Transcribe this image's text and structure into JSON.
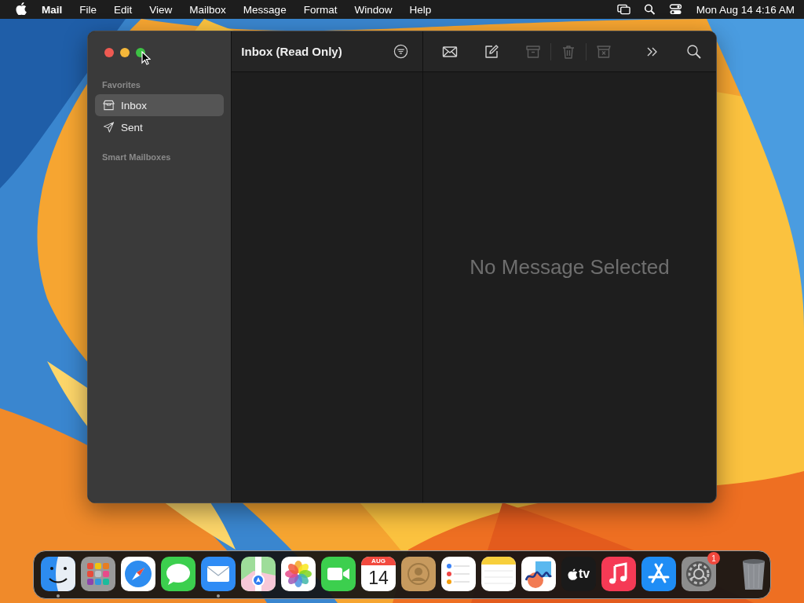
{
  "menu_bar": {
    "app_name": "Mail",
    "menus": [
      "File",
      "Edit",
      "View",
      "Mailbox",
      "Message",
      "Format",
      "Window",
      "Help"
    ],
    "clock": "Mon Aug 14 4:16 AM"
  },
  "window": {
    "sidebar": {
      "sections": [
        {
          "heading": "Favorites",
          "items": [
            {
              "label": "Inbox",
              "kind": "inbox",
              "selected": true
            },
            {
              "label": "Sent",
              "kind": "sent",
              "selected": false
            }
          ]
        },
        {
          "heading": "Smart Mailboxes"
        }
      ]
    },
    "message_list": {
      "title": "Inbox (Read Only)"
    },
    "toolbar": [
      {
        "kind": "get-mail",
        "disabled": false
      },
      {
        "kind": "compose",
        "disabled": false
      },
      {
        "kind": "archive",
        "disabled": true
      },
      {
        "kind": "trash",
        "disabled": true
      },
      {
        "kind": "junk",
        "disabled": true
      },
      {
        "kind": "more",
        "disabled": false
      },
      {
        "kind": "search",
        "disabled": false
      }
    ],
    "viewer": {
      "empty_text": "No Message Selected"
    }
  },
  "dock": [
    {
      "kind": "finder",
      "running": true
    },
    {
      "kind": "launchpad",
      "running": false
    },
    {
      "kind": "safari",
      "running": false
    },
    {
      "kind": "messages",
      "running": false
    },
    {
      "kind": "mail",
      "running": true
    },
    {
      "kind": "maps",
      "running": false
    },
    {
      "kind": "photos",
      "running": false
    },
    {
      "kind": "facetime",
      "running": false
    },
    {
      "kind": "calendar",
      "running": false,
      "month": "AUG",
      "day": "14"
    },
    {
      "kind": "contacts",
      "running": false
    },
    {
      "kind": "reminders",
      "running": false
    },
    {
      "kind": "notes",
      "running": false
    },
    {
      "kind": "freeform",
      "running": false
    },
    {
      "kind": "tv",
      "running": false,
      "label": "tv"
    },
    {
      "kind": "music",
      "running": false
    },
    {
      "kind": "appstore",
      "running": false
    },
    {
      "kind": "settings",
      "running": false,
      "badge": "1"
    },
    {
      "kind": "trash",
      "running": false
    }
  ]
}
